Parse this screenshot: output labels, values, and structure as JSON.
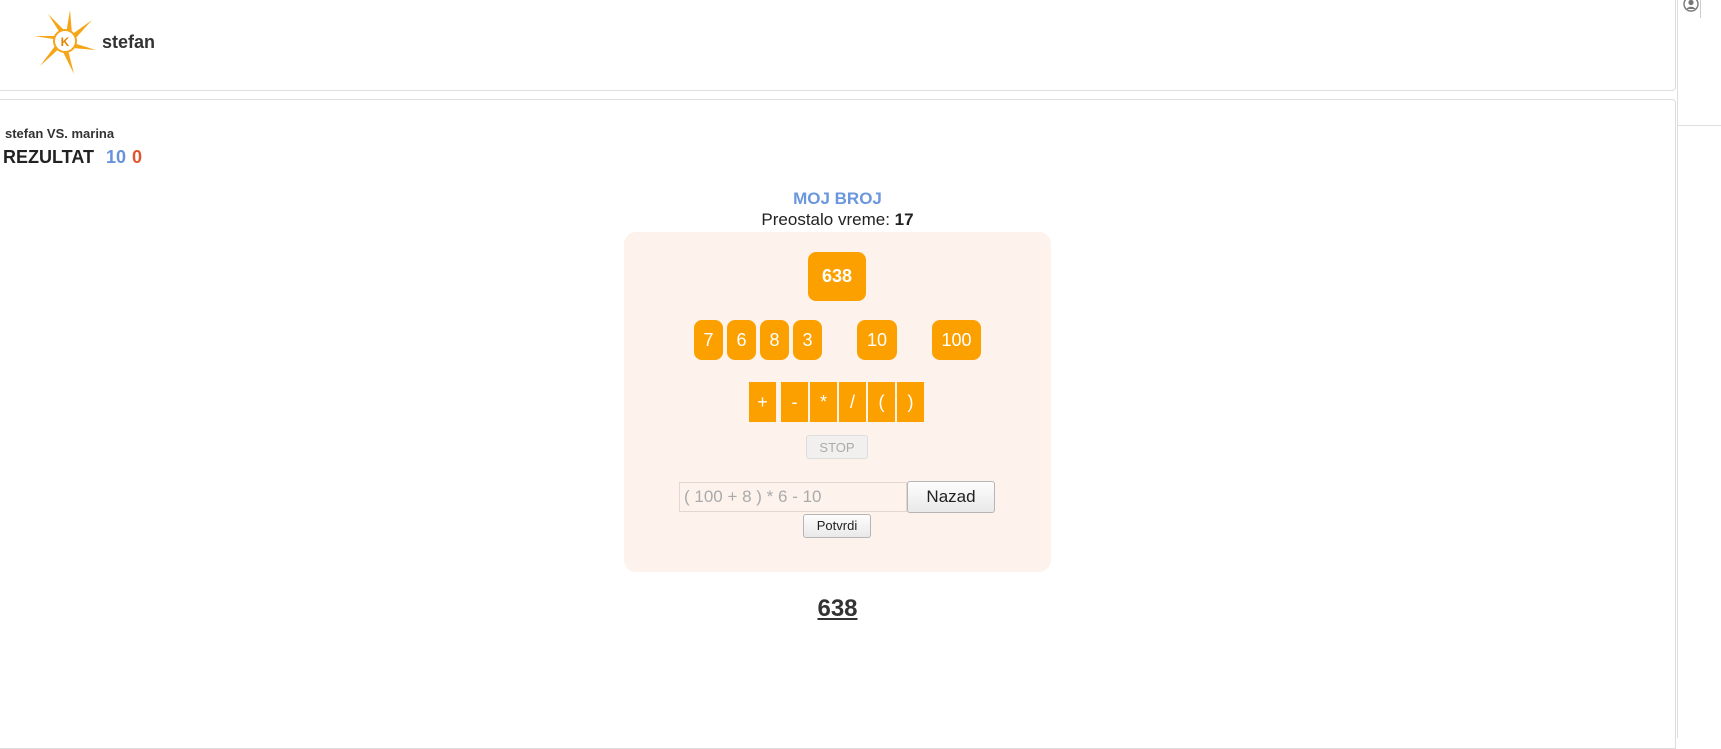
{
  "header": {
    "username": "stefan",
    "logo_icon": "lightning-star-logo-icon"
  },
  "match": {
    "versus": "stefan VS. marina",
    "result_label": "REZULTAT",
    "score_player": "10",
    "score_opponent": "0"
  },
  "game": {
    "title": "MOJ BROJ",
    "time_label": "Preostalo vreme: ",
    "time_value": "17",
    "target": "638",
    "numbers": [
      "7",
      "6",
      "8",
      "3",
      "10",
      "100"
    ],
    "operators": [
      "+",
      "-",
      "*",
      "/",
      "(",
      ")"
    ],
    "stop_label": "STOP",
    "expression_value": "( 100 + 8 ) * 6  - 10",
    "back_label": "Nazad",
    "confirm_label": "Potvrdi",
    "result": "638"
  },
  "colors": {
    "tile": "#fca000",
    "title_blue": "#6b97dd",
    "score_blue": "#6793de",
    "score_red": "#e0552d",
    "panel_bg": "#fdf3ec"
  }
}
